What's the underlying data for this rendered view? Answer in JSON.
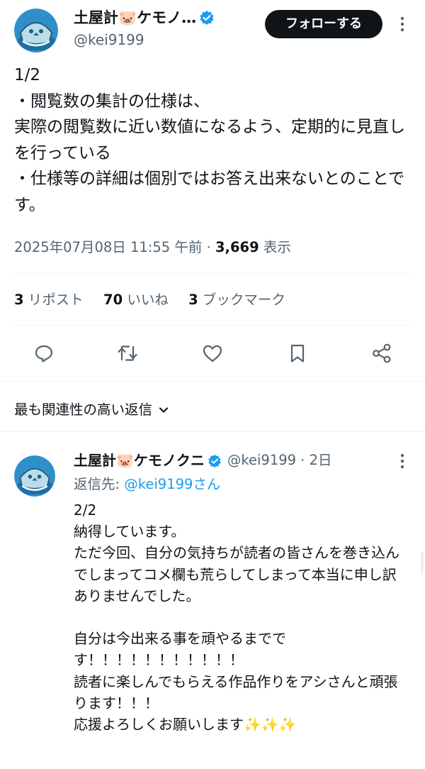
{
  "tweet": {
    "author_name": "土屋計🐷ケモノ…",
    "handle": "@kei9199",
    "follow_label": "フォローする",
    "text": "1/2\n・閲覧数の集計の仕様は、\n実際の閲覧数に近い数値になるよう、定期的に見直しを行っている\n・仕様等の詳細は個別ではお答え出来ないとのことです。",
    "timestamp": "2025年07月08日 11:55 午前",
    "separator": "·",
    "views_count": "3,669",
    "views_label": "表示",
    "stats": {
      "reposts_count": "3",
      "reposts_label": "リポスト",
      "likes_count": "70",
      "likes_label": "いいね",
      "bookmarks_count": "3",
      "bookmarks_label": "ブックマーク"
    },
    "actions": [
      "reply-icon",
      "repost-icon",
      "like-icon",
      "bookmark-icon",
      "share-icon"
    ]
  },
  "replies_sort": {
    "label": "最も関連性の高い返信"
  },
  "reply": {
    "author_name": "土屋計🐷ケモノクニ",
    "handle_time": "@kei9199 · 2日",
    "reply_to_prefix": "返信先:",
    "reply_to_handle": "@kei9199さん",
    "text": "2/2\n納得しています。\nただ今回、自分の気持ちが読者の皆さんを巻き込んでしまってコメ欄も荒らしてしまって本当に申し訳ありませんでした。\n\n自分は今出来る事を頑やるまでです！！！！！！！！！！！\n読者に楽しんでもらえる作品作りをアシさんと頑張ります！！！\n応援よろしくお願いします✨✨✨"
  },
  "colors": {
    "text": "#0f1419",
    "secondary": "#536471",
    "accent": "#1d9bf0",
    "follow_bg": "#0f1419",
    "divider": "#eff3f4"
  }
}
